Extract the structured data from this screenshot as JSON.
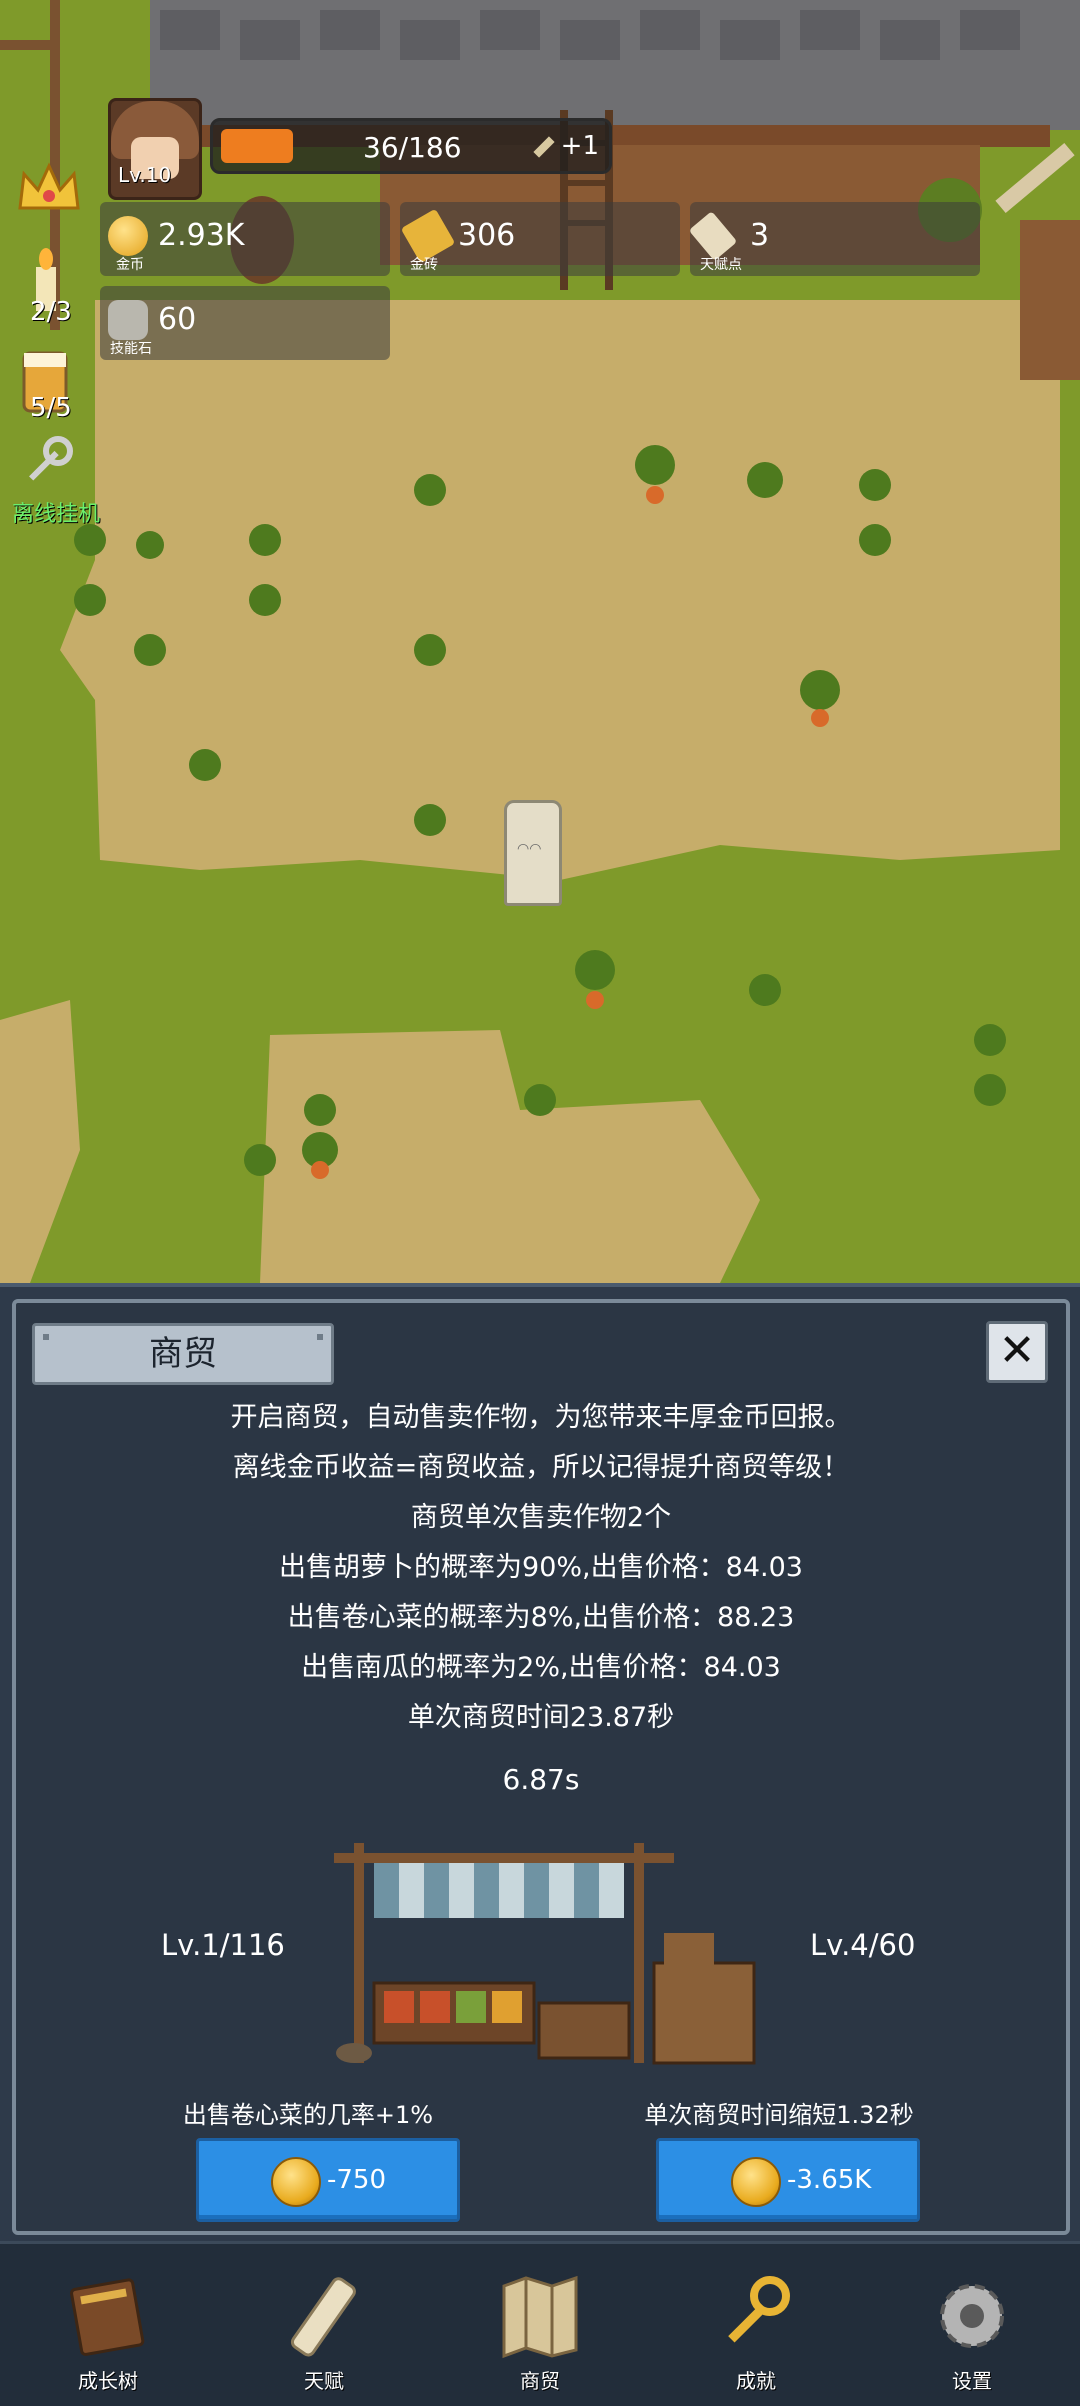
{
  "hud": {
    "level": "Lv.10",
    "xp_text": "36/186",
    "xp_fraction": 0.19,
    "xp_bonus": "+1",
    "gold": {
      "value": "2.93K",
      "caption": "金币"
    },
    "brick": {
      "value": "306",
      "caption": "金砖"
    },
    "talent": {
      "value": "3",
      "caption": "天赋点"
    },
    "skillstone": {
      "value": "60",
      "caption": "技能石"
    },
    "candle_count": "2/3",
    "mug_count": "5/5",
    "auto_label": "离线挂机"
  },
  "trade_panel": {
    "title": "商贸",
    "description": [
      "开启商贸，自动售卖作物，为您带来丰厚金币回报。",
      "离线金币收益=商贸收益，所以记得提升商贸等级！",
      "商贸单次售卖作物2个",
      "出售胡萝卜的概率为90%,出售价格：84.03",
      "出售卷心菜的概率为8%,出售价格：88.23",
      "出售南瓜的概率为2%,出售价格：84.03",
      "单次商贸时间23.87秒"
    ],
    "timer": "6.87s",
    "left_level": "Lv.1/116",
    "right_level": "Lv.4/60",
    "left_upgrade": {
      "text": "出售卷心菜的几率+1%",
      "cost": "-750"
    },
    "right_upgrade": {
      "text": "单次商贸时间缩短1.32秒",
      "cost": "-3.65K"
    }
  },
  "nav": {
    "items": [
      {
        "label": "成长树",
        "icon": "book-icon"
      },
      {
        "label": "天赋",
        "icon": "scroll-icon"
      },
      {
        "label": "商贸",
        "icon": "map-icon"
      },
      {
        "label": "成就",
        "icon": "key-icon"
      },
      {
        "label": "设置",
        "icon": "gear-icon"
      }
    ]
  },
  "colors": {
    "accent_orange": "#ee7d1f",
    "button_blue": "#2c8fe5",
    "panel_bg": "#2b3644",
    "grass": "#7f9a2a",
    "dirt": "#c8b16e"
  }
}
